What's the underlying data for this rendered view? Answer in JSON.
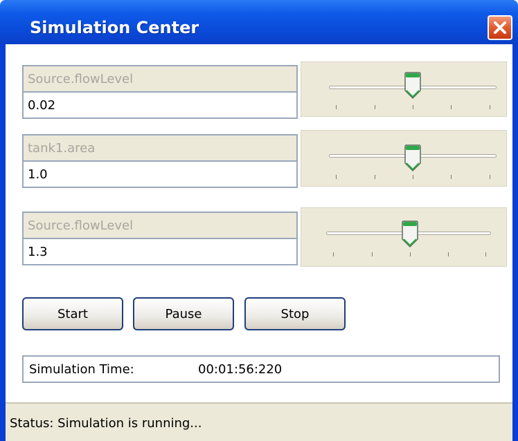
{
  "window": {
    "title": "Simulation Center",
    "close_icon": "close-icon"
  },
  "parameters": [
    {
      "label": "Source.flowLevel",
      "value": "0.02",
      "slider_fraction": 0.5
    },
    {
      "label": "tank1.area",
      "value": "1.0",
      "slider_fraction": 0.5
    },
    {
      "label": "Source.flowLevel",
      "value": "1.3",
      "slider_fraction": 0.5
    }
  ],
  "controls": {
    "start_label": "Start",
    "pause_label": "Pause",
    "stop_label": "Stop"
  },
  "simulation_time": {
    "label": "Simulation Time:",
    "value": "00:01:56:220"
  },
  "status": {
    "text": "Status: Simulation is running..."
  },
  "colors": {
    "title_bar": "#0a4ad8",
    "panel_bg": "#ece9d8",
    "thumb_accent": "#2ea84a",
    "close_button": "#e05a2e"
  }
}
